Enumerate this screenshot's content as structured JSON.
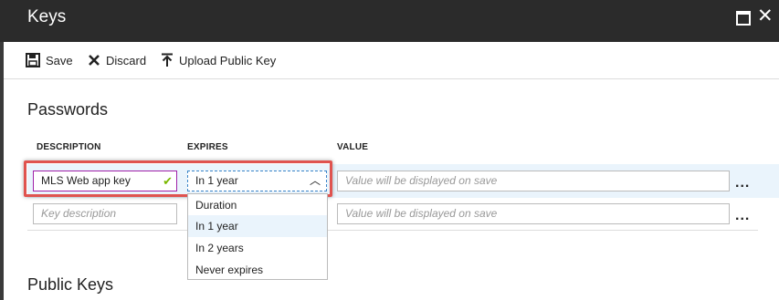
{
  "window": {
    "title": "Keys"
  },
  "toolbar": {
    "save_label": "Save",
    "discard_label": "Discard",
    "upload_label": "Upload Public Key"
  },
  "passwords": {
    "title": "Passwords",
    "columns": {
      "description": "DESCRIPTION",
      "expires": "EXPIRES",
      "value": "VALUE"
    },
    "rows": [
      {
        "description": "MLS Web app key",
        "expires": "In 1 year",
        "value_placeholder": "Value will be displayed on save"
      },
      {
        "description_placeholder": "Key description",
        "value_placeholder": "Value will be displayed on save"
      }
    ],
    "more_label": "...",
    "expires_options": [
      "Duration",
      "In 1 year",
      "In 2 years",
      "Never expires"
    ],
    "selected_option": "In 1 year"
  },
  "public_keys": {
    "title": "Public Keys"
  },
  "colors": {
    "titlebar": "#2b2b2b",
    "highlight": "#e0534f",
    "check": "#7ab800",
    "focus": "#a020a8"
  }
}
